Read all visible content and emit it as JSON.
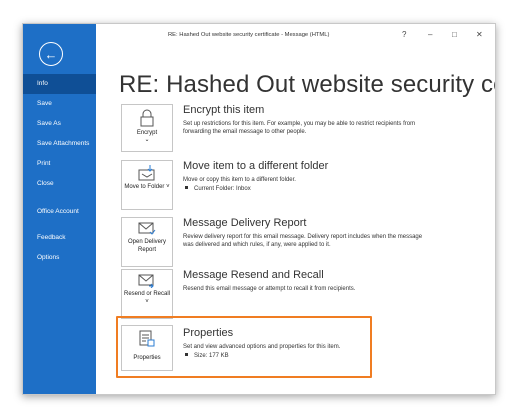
{
  "window": {
    "title": "RE: Hashed Out website security certificate  -  Message (HTML)",
    "help": "?",
    "minimize": "–",
    "maximize": "□",
    "close": "✕"
  },
  "sidebar": {
    "back_icon": "back-arrow-icon",
    "items": [
      {
        "label": "Info",
        "active": true
      },
      {
        "label": "Save"
      },
      {
        "label": "Save As"
      },
      {
        "label": "Save Attachments"
      },
      {
        "label": "Print"
      },
      {
        "label": "Close"
      },
      {
        "label": "Office Account"
      },
      {
        "label": "Feedback"
      },
      {
        "label": "Options"
      }
    ]
  },
  "main": {
    "heading": "RE: Hashed Out website security certific…",
    "sections": [
      {
        "button_label": "Encrypt",
        "button_sub": "⌄",
        "title": "Encrypt this item",
        "description": "Set up restrictions for this item. For example, you may be able to restrict recipients from forwarding the email message to other people."
      },
      {
        "button_label": "Move to Folder ˅",
        "title": "Move item to a different folder",
        "description": "Move or copy this item to a different folder.",
        "bullet": "Current Folder:  Inbox"
      },
      {
        "button_label": "Open Delivery Report",
        "title": "Message Delivery Report",
        "description": "Review delivery report for this email message. Delivery report includes when the message was delivered and which rules, if any, were applied to it."
      },
      {
        "button_label": "Resend or Recall ˅",
        "title": "Message Resend and Recall",
        "description": "Resend this email message or attempt to recall it from recipients."
      },
      {
        "button_label": "Properties",
        "title": "Properties",
        "description": "Set and view advanced options and properties for this item.",
        "bullet": "Size:   177 KB"
      }
    ]
  },
  "colors": {
    "sidebar": "#1e6fc6",
    "sidebar_active": "#0f4f96",
    "highlight": "#f07d22"
  }
}
